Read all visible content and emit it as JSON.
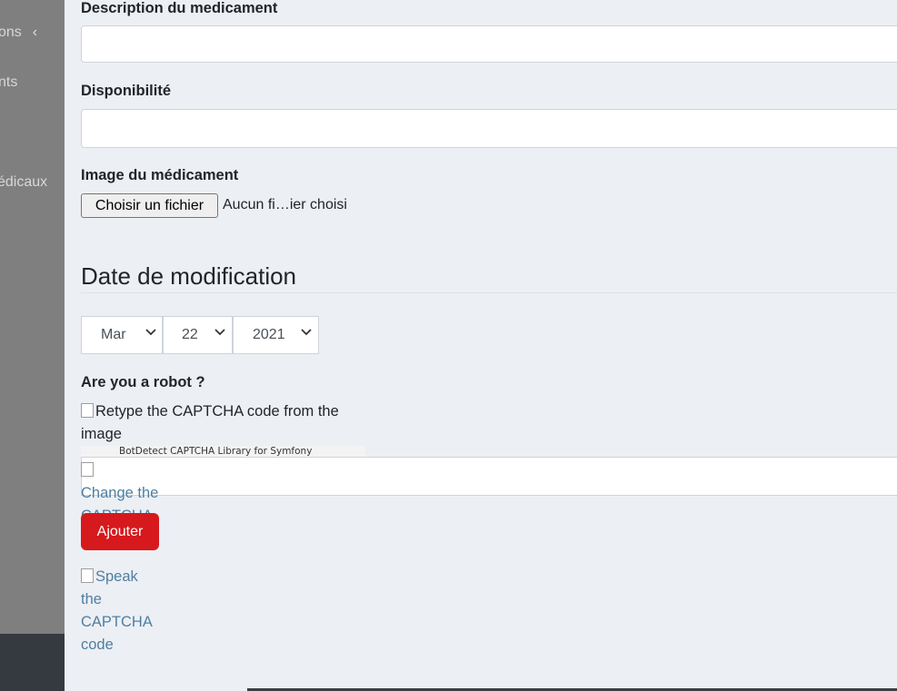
{
  "sidebar": {
    "items": [
      {
        "label": "ons",
        "chevron": "‹"
      },
      {
        "label": "nts"
      },
      {
        "label": "édicaux"
      }
    ]
  },
  "form": {
    "description_label": "Description du medicament",
    "description_value": "",
    "availability_label": "Disponibilité",
    "availability_value": "",
    "image_label": "Image du médicament",
    "file_button_label": "Choisir un fichier",
    "file_status": "Aucun fi…ier choisi",
    "date_section_title": "Date de modification",
    "date": {
      "month": "Mar",
      "day": "22",
      "year": "2021"
    },
    "captcha_label": "Are you a robot ?",
    "captcha_image_alt": "Retype the CAPTCHA code from the image",
    "captcha_library": "BotDetect CAPTCHA Library for Symfony",
    "captcha_value": "",
    "change_code_link": "Change the CAPTCHA code",
    "speak_code_link": "Speak the CAPTCHA code",
    "submit_label": "Ajouter"
  },
  "icons": {
    "select_arrow": "chevron-down-icon",
    "broken_image": "broken-image-icon"
  },
  "colors": {
    "submit_button": "#d6191c",
    "link": "#4e7fa1",
    "sidebar": "#7f7f7f"
  }
}
